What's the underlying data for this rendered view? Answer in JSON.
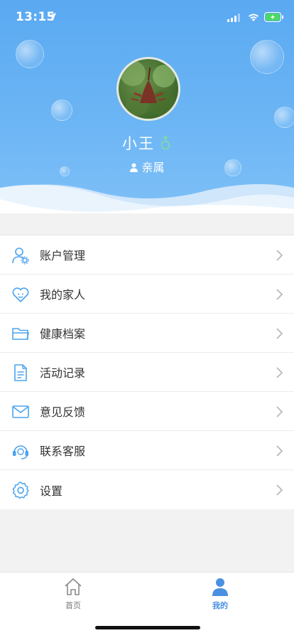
{
  "status_bar": {
    "time": "13:15"
  },
  "profile": {
    "name": "小王",
    "role": "亲属"
  },
  "menu": {
    "items": [
      {
        "label": "账户管理",
        "icon": "account-settings-icon"
      },
      {
        "label": "我的家人",
        "icon": "heart-family-icon"
      },
      {
        "label": "健康档案",
        "icon": "folder-icon"
      },
      {
        "label": "活动记录",
        "icon": "document-icon"
      },
      {
        "label": "意见反馈",
        "icon": "mail-icon"
      },
      {
        "label": "联系客服",
        "icon": "headset-icon"
      },
      {
        "label": "设置",
        "icon": "gear-icon"
      }
    ]
  },
  "tabbar": {
    "home_label": "首页",
    "mine_label": "我的",
    "active": "mine"
  },
  "colors": {
    "header": "#5aa9f1",
    "accent": "#4a90e2",
    "icon": "#4aa3ee",
    "gender_male": "#7ad6b0"
  }
}
